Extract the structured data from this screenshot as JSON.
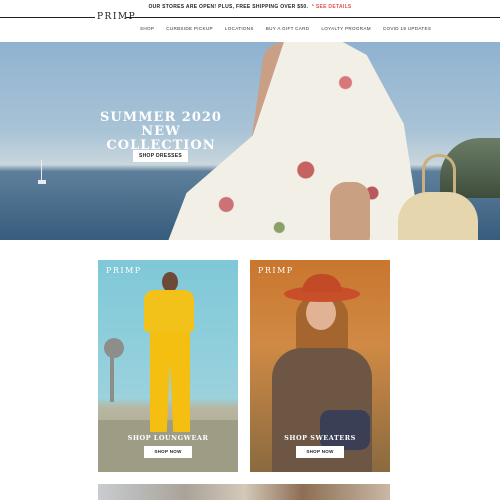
{
  "announcement": {
    "text": "OUR STORES ARE OPEN! PLUS, FREE SHIPPING OVER $50.",
    "link": "* SEE DETAILS"
  },
  "brand": {
    "logo": "PRIMP"
  },
  "nav": {
    "items": [
      "SHOP",
      "CURBSIDE PICKUP",
      "LOCATIONS",
      "BUY A GIFT CARD",
      "LOYALTY PROGRAM",
      "COVID 19 UPDATES"
    ]
  },
  "hero": {
    "title_line1": "SUMMER 2020",
    "title_line2": "NEW COLLECTION",
    "button": "SHOP DRESSES"
  },
  "cards": [
    {
      "brand": "PRIMP",
      "brand_sub": "·········",
      "label": "SHOP LOUNGWEAR",
      "button": "SHOP NOW"
    },
    {
      "brand": "PRIMP",
      "brand_sub": "·········",
      "label": "SHOP SWEATERS",
      "button": "SHOP NOW"
    }
  ],
  "colors": {
    "accent": "#e0524d",
    "text": "#222222",
    "background": "#ffffff"
  }
}
